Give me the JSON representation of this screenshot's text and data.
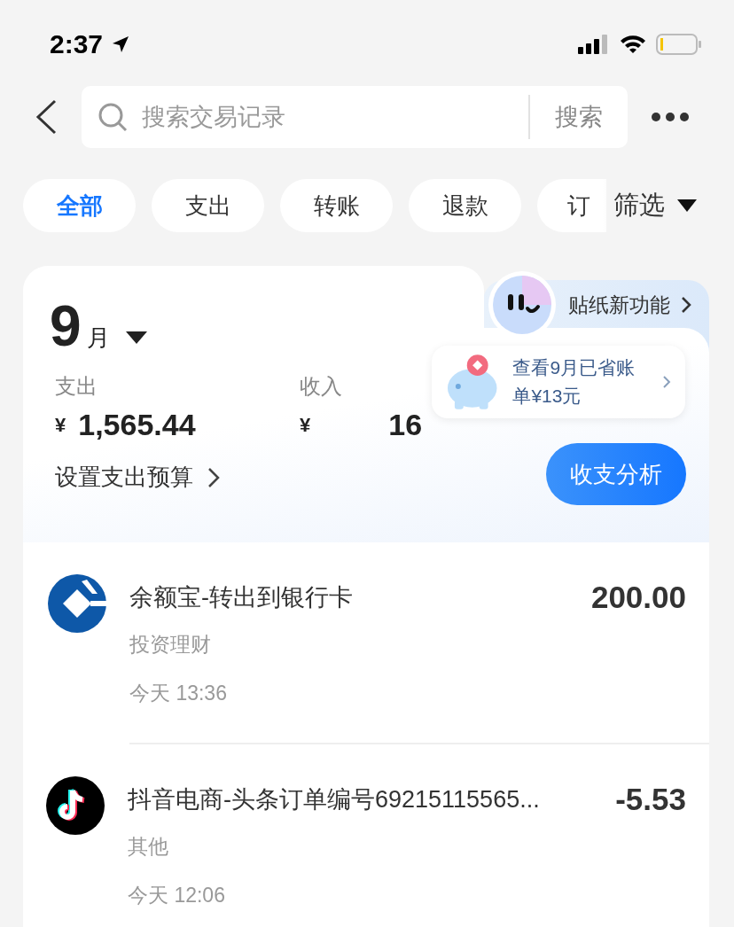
{
  "status_bar": {
    "time": "2:37"
  },
  "header": {
    "search": {
      "placeholder": "搜索交易记录",
      "button": "搜索"
    }
  },
  "filters": [
    {
      "label": "全部",
      "selected": true
    },
    {
      "label": "支出",
      "selected": false
    },
    {
      "label": "转账",
      "selected": false
    },
    {
      "label": "退款",
      "selected": false
    },
    {
      "label": "订",
      "selected": false
    }
  ],
  "filter_button": "筛选",
  "summary": {
    "month": "9",
    "month_unit": "月",
    "sticker_promo": "贴纸新功能",
    "savings_tip": "查看9月已省账单¥13元",
    "expense": {
      "label": "支出",
      "currency": "¥",
      "amount": "1,565.44"
    },
    "income": {
      "label": "收入",
      "currency": "¥",
      "amount": "16"
    },
    "budget_link": "设置支出预算",
    "analysis_button": "收支分析"
  },
  "transactions": [
    {
      "kind": "bank",
      "title": "余额宝-转出到银行卡",
      "category": "投资理财",
      "time": "今天 13:36",
      "amount": "200.00"
    },
    {
      "kind": "tiktok",
      "title": "抖音电商-头条订单编号69215115565...",
      "category": "其他",
      "time": "今天 12:06",
      "amount": "-5.53"
    }
  ]
}
